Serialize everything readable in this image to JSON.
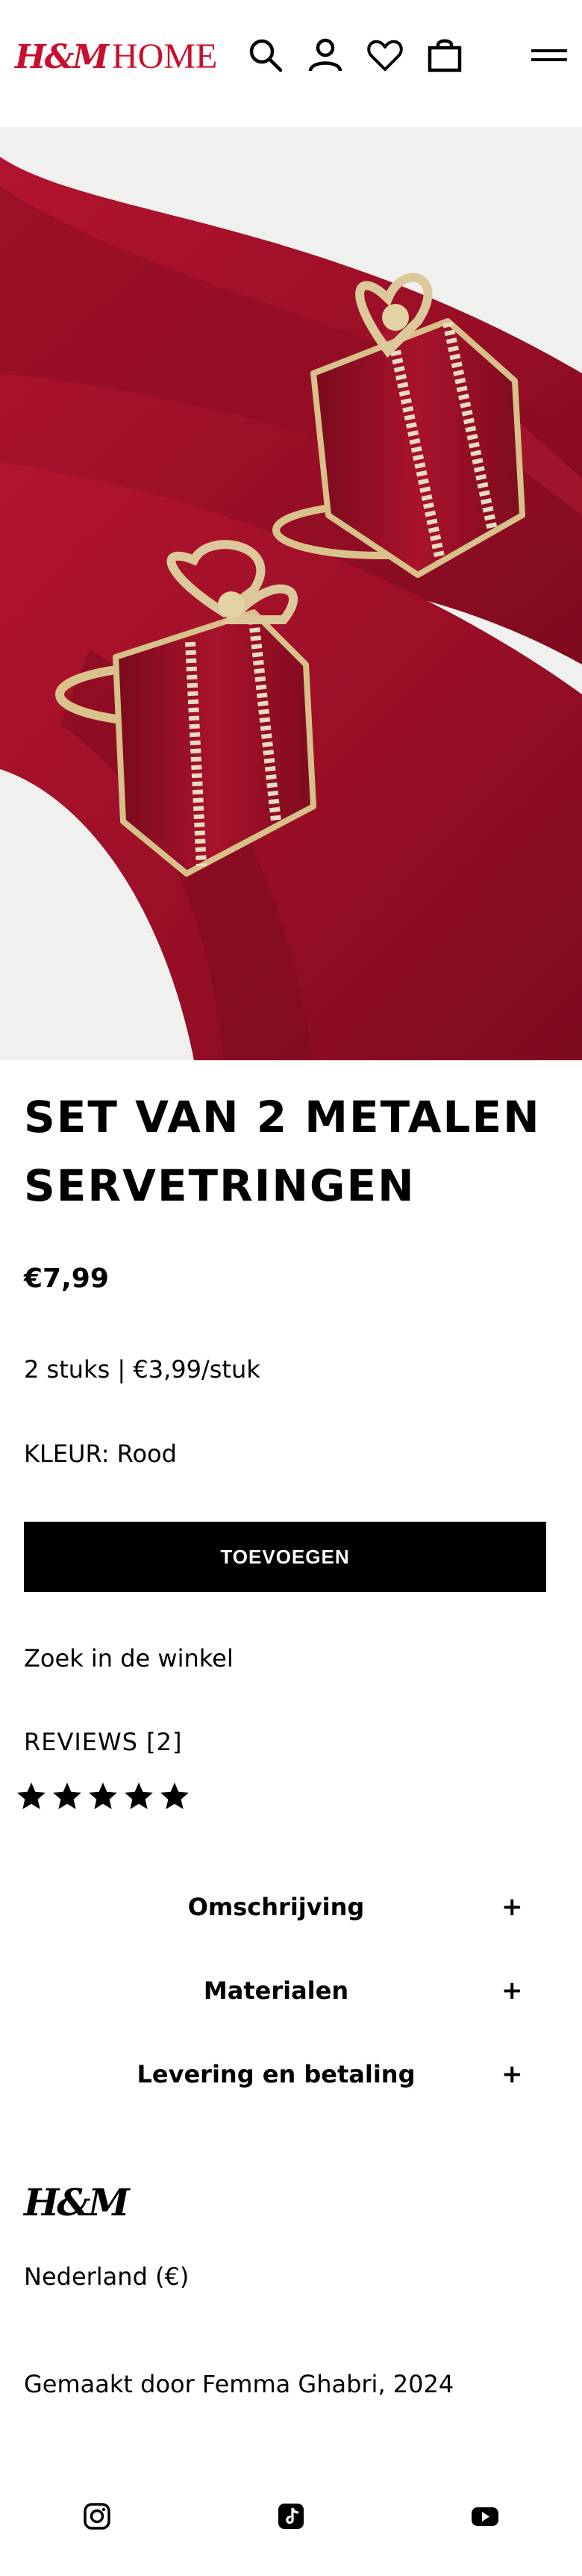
{
  "header": {
    "logo_hm": "H&M",
    "logo_home": "HOME",
    "icons": [
      "search-icon",
      "account-icon",
      "heart-icon",
      "bag-icon",
      "menu-icon"
    ]
  },
  "product": {
    "title": "SET VAN 2 METALEN SERVETRINGEN",
    "price": "€7,99",
    "unit_price": "2 stuks | €3,99/stuk",
    "color_label": "KLEUR: Rood",
    "add_button": "TOEVOEGEN",
    "store_link": "Zoek in de winkel",
    "reviews_label": "REVIEWS [2]",
    "rating": 5,
    "rating_max": 5,
    "image_colors": {
      "napkin": "#a3102a",
      "gift": "#9a0e25",
      "gold": "#d8c08a"
    }
  },
  "accordion": [
    {
      "label": "Omschrijving",
      "toggle": "+"
    },
    {
      "label": "Materialen",
      "toggle": "+"
    },
    {
      "label": "Levering en betaling",
      "toggle": "+"
    }
  ],
  "footer": {
    "logo": "H&M",
    "country": "Nederland (€)",
    "credit": "Gemaakt door Femma Ghabri, 2024",
    "social": [
      "instagram-icon",
      "tiktok-icon",
      "youtube-icon"
    ]
  },
  "colors": {
    "brand_red": "#c8102e",
    "button_bg": "#000000",
    "button_text": "#ffffff"
  }
}
